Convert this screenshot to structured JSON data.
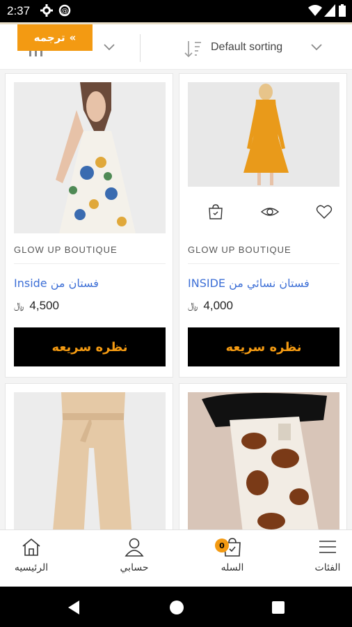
{
  "status_bar": {
    "time": "2:37"
  },
  "toolbar": {
    "translate_label": "ترجمه",
    "translate_arrows": "«",
    "sort_label": "Default sorting"
  },
  "products": [
    {
      "brand": "GLOW UP BOUTIQUE",
      "title": "فستان من Inside",
      "price": "4,500",
      "currency": "﷼",
      "quick_view": "نظره سريعه"
    },
    {
      "brand": "GLOW UP BOUTIQUE",
      "title": "فستان نسائي من INSIDE",
      "price": "4,000",
      "currency": "﷼",
      "quick_view": "نظره سريعه"
    },
    {
      "brand": "",
      "title": "",
      "price": "",
      "currency": "",
      "quick_view": ""
    },
    {
      "brand": "",
      "title": "",
      "price": "",
      "currency": "",
      "quick_view": ""
    }
  ],
  "bottom_nav": {
    "home": "الرئيسيه",
    "account": "حسابي",
    "cart": "السله",
    "cart_count": "0",
    "categories": "الفئات"
  },
  "colors": {
    "accent": "#f39a12",
    "link": "#3d6fd6",
    "button_bg": "#000000"
  }
}
